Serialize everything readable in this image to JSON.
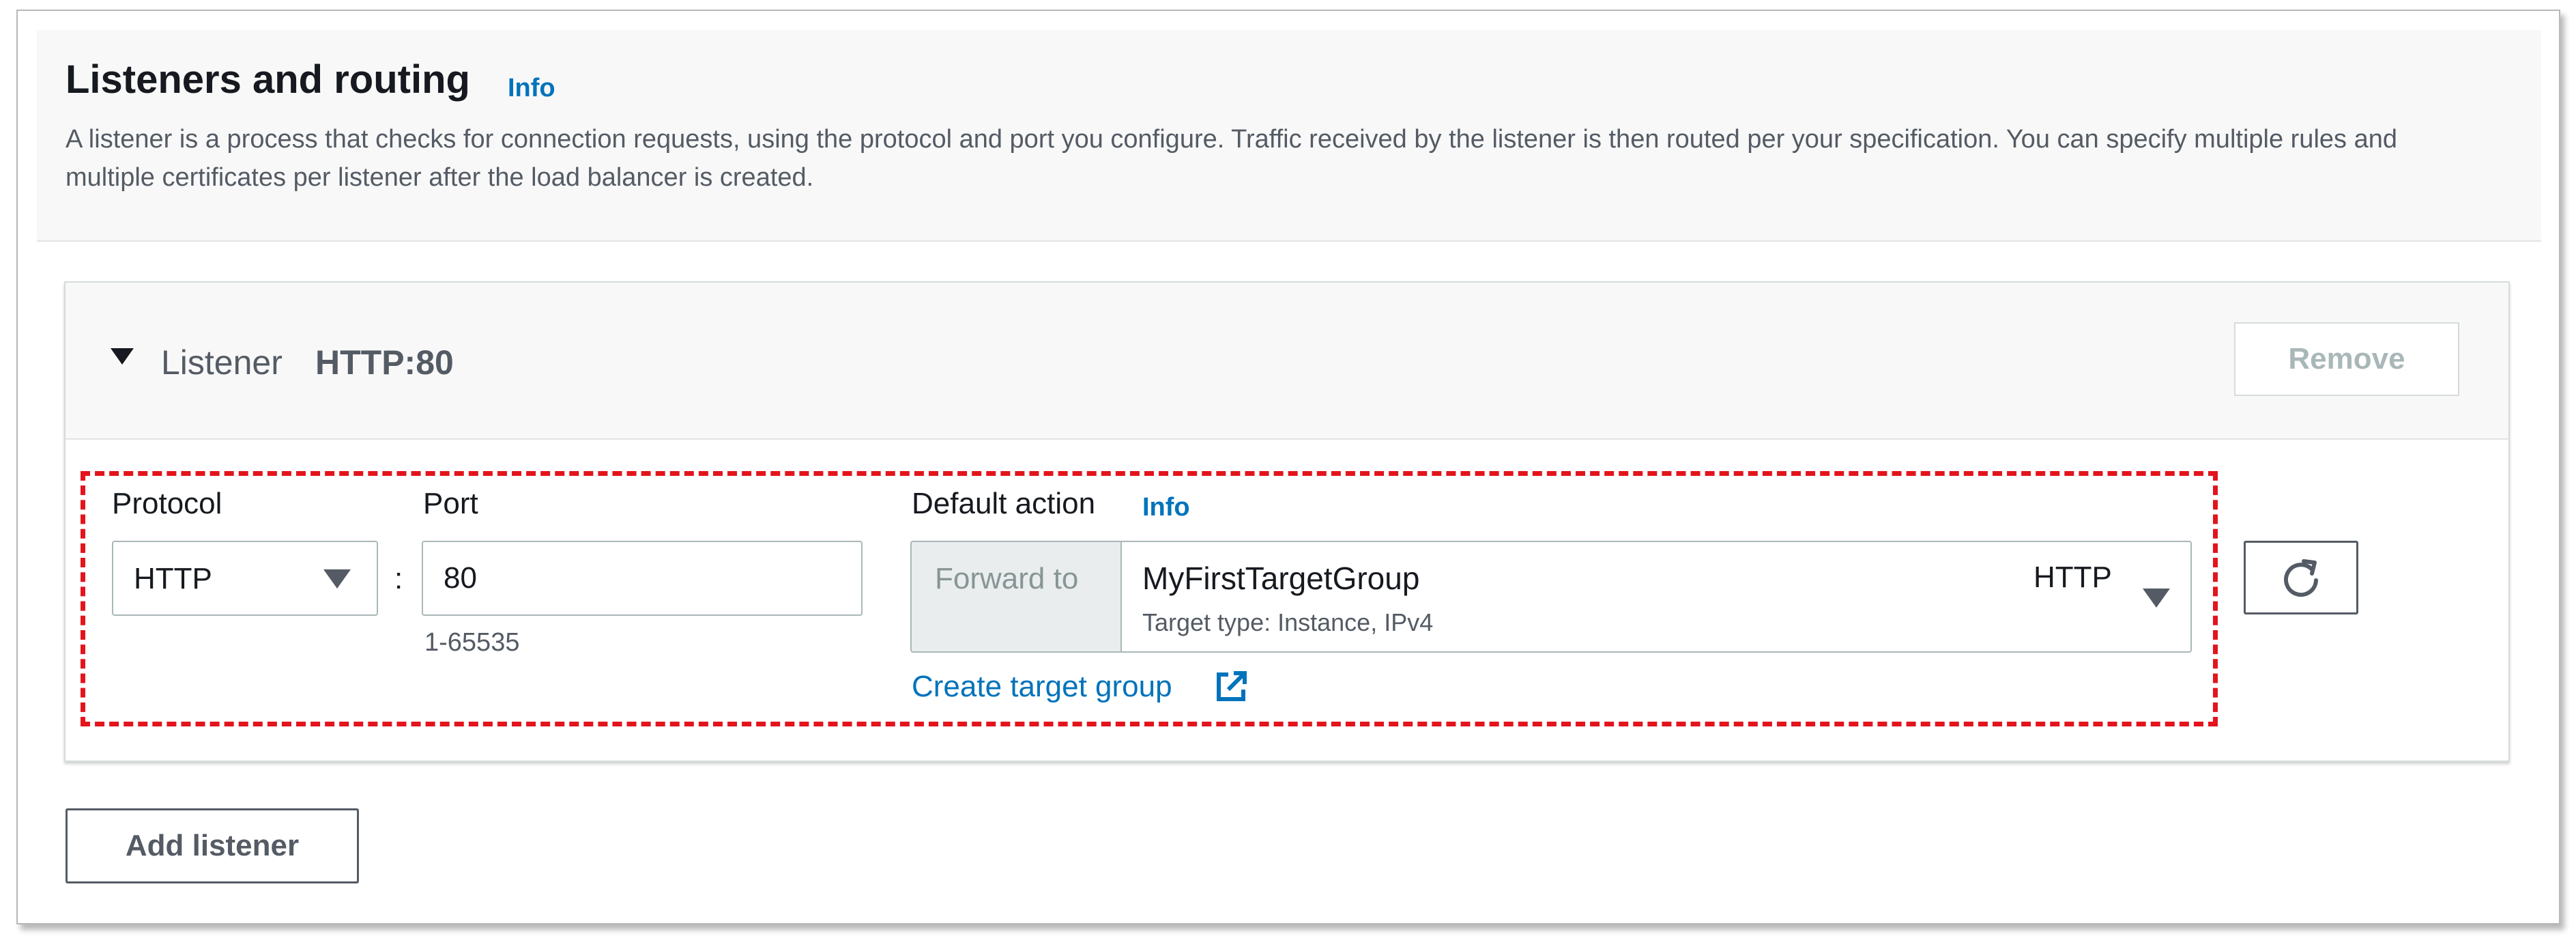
{
  "section": {
    "title": "Listeners and routing",
    "info_label": "Info",
    "description": "A listener is a process that checks for connection requests, using the protocol and port you configure. Traffic received by the listener is then routed per your specification. You can specify multiple rules and multiple certificates per listener after the load balancer is created."
  },
  "listener": {
    "label": "Listener",
    "value": "HTTP:80",
    "remove_label": "Remove",
    "protocol": {
      "label": "Protocol",
      "selected": "HTTP"
    },
    "separator": ":",
    "port": {
      "label": "Port",
      "value": "80",
      "hint": "1-65535"
    },
    "default_action": {
      "label": "Default action",
      "info_label": "Info",
      "prefix": "Forward to",
      "target_group": {
        "name": "MyFirstTargetGroup",
        "details": "Target type: Instance, IPv4",
        "protocol": "HTTP"
      },
      "create_link": "Create target group"
    }
  },
  "add_listener_label": "Add listener",
  "colors": {
    "link": "#0073bb",
    "highlight": "#e3141c",
    "text": "#16191f",
    "muted": "#545b64"
  },
  "icons": {
    "expand": "caret-down-icon",
    "select": "dropdown-caret-icon",
    "external": "external-link-icon",
    "refresh": "refresh-icon"
  }
}
